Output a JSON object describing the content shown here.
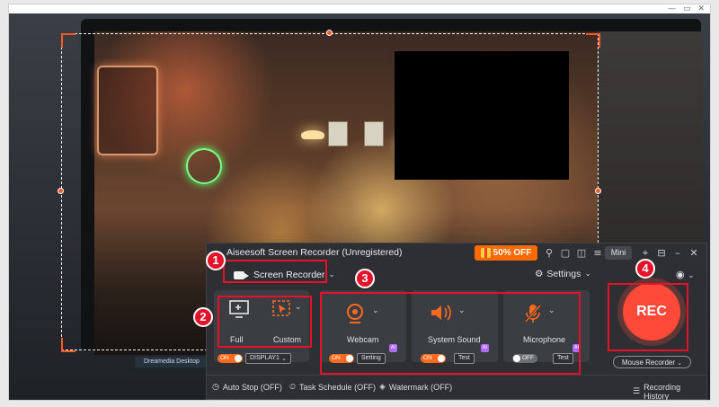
{
  "top_controls": {
    "minimize": "—",
    "restore": "▭",
    "close": "✕"
  },
  "taskbar_text": "Dreamedia Desktop",
  "recorder": {
    "title": "Aiseesoft Screen Recorder (Unregistered)",
    "promo": "50% OFF",
    "mini_label": "Mini",
    "mode": "Screen Recorder",
    "settings_label": "Settings",
    "area": {
      "full_label": "Full",
      "custom_label": "Custom",
      "full_toggle": "ON",
      "display_value": "DISPLAY1"
    },
    "webcam": {
      "label": "Webcam",
      "toggle": "ON",
      "button": "Setting"
    },
    "system_sound": {
      "label": "System Sound",
      "toggle": "ON",
      "button": "Test"
    },
    "microphone": {
      "label": "Microphone",
      "toggle": "OFF",
      "button": "Test"
    },
    "ai_badge": "AI",
    "rec_label": "REC",
    "mouse_recorder": "Mouse Recorder",
    "bottom": {
      "auto_stop": "Auto Stop (OFF)",
      "task_schedule": "Task Schedule (OFF)",
      "watermark": "Watermark (OFF)",
      "history": "Recording History"
    }
  },
  "annotations": [
    "1",
    "2",
    "3",
    "4"
  ],
  "colors": {
    "accent": "#ff5a1f",
    "annotation": "#e5122a",
    "panel": "#2d2f33",
    "rec": "#ff4a3a"
  }
}
